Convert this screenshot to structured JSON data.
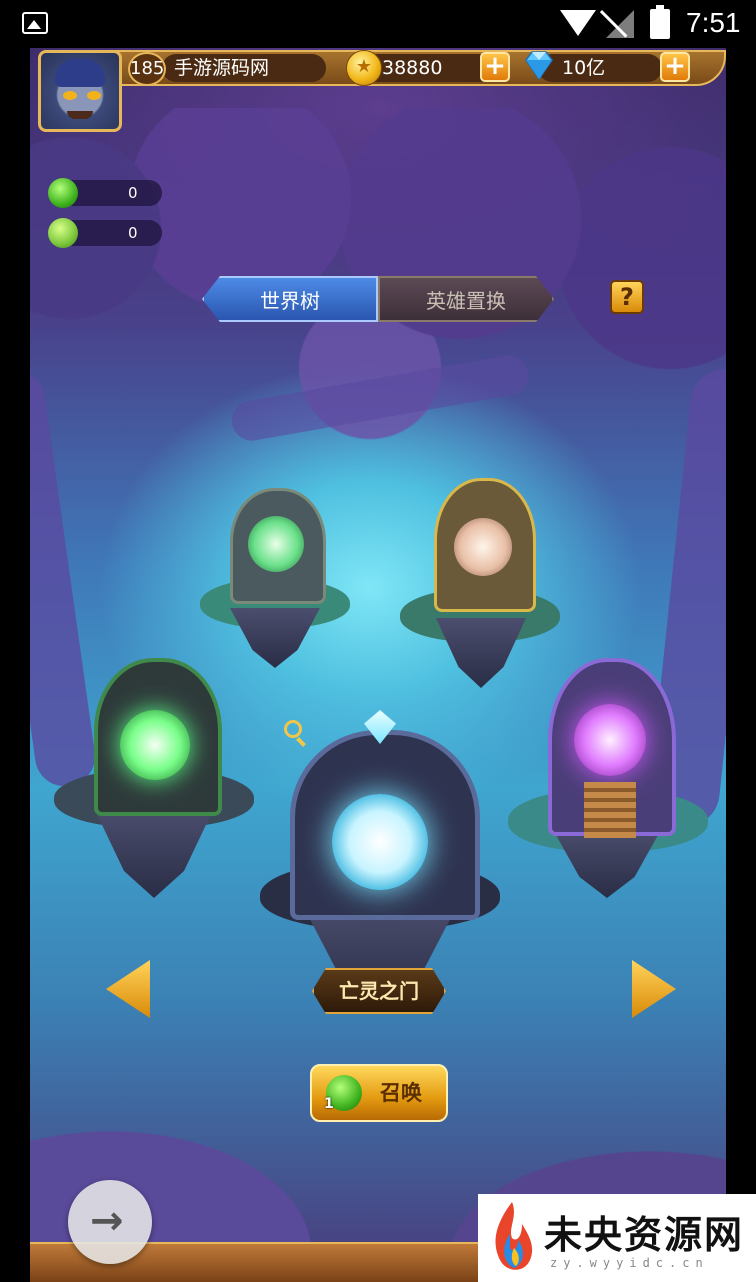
{
  "status_bar": {
    "time": "7:51"
  },
  "player": {
    "level": "185",
    "name": "手游源码网",
    "gold": "38880",
    "diamonds": "10亿"
  },
  "resources": [
    {
      "icon": "green-soul-orb-icon",
      "value": "0"
    },
    {
      "icon": "green-frog-icon",
      "value": "0"
    }
  ],
  "tabs": [
    {
      "label": "世界树",
      "active": true
    },
    {
      "label": "英雄置换",
      "active": false
    }
  ],
  "help_label": "?",
  "selected_portal": "亡灵之门",
  "summon": {
    "label": "召唤",
    "count": "1"
  },
  "watermark": {
    "title": "未央资源网",
    "url": "zy.wyyidc.cn"
  },
  "colors": {
    "accent_gold": "#e7b85a",
    "tab_active": "#3a6fd0",
    "portal_green": "#5cff8a",
    "portal_purple": "#d35cff"
  }
}
